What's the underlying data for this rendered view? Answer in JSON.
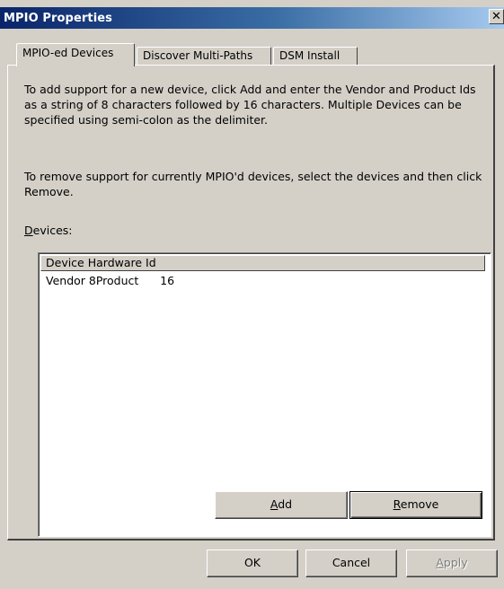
{
  "window": {
    "title": "MPIO Properties",
    "close_glyph": "✕"
  },
  "tabs": [
    {
      "label": "MPIO-ed Devices",
      "active": true
    },
    {
      "label": "Discover Multi-Paths",
      "active": false
    },
    {
      "label": "DSM Install",
      "active": false
    }
  ],
  "panel": {
    "instructions_add": "To add support for a new device, click Add and enter the Vendor and Product Ids as a string of 8 characters followed by 16 characters. Multiple Devices can be specified using semi-colon as the delimiter.",
    "instructions_remove": "To remove support for currently MPIO'd devices, select the devices and then click Remove.",
    "devices_label_accel": "D",
    "devices_label_rest": "evices:",
    "list": {
      "column_header": "Device Hardware Id",
      "rows": [
        "Vendor 8Product      16"
      ]
    },
    "add_button_accel": "A",
    "add_button_rest": "dd",
    "remove_button_accel": "R",
    "remove_button_rest": "emove"
  },
  "footer": {
    "ok_label": "OK",
    "cancel_label": "Cancel",
    "apply_accel": "A",
    "apply_rest": "pply",
    "apply_enabled": false
  },
  "colors": {
    "dialog_face": "#d4d0c8",
    "titlebar_start": "#0a246a",
    "titlebar_end": "#a6caf0",
    "disabled_text": "#808080"
  }
}
